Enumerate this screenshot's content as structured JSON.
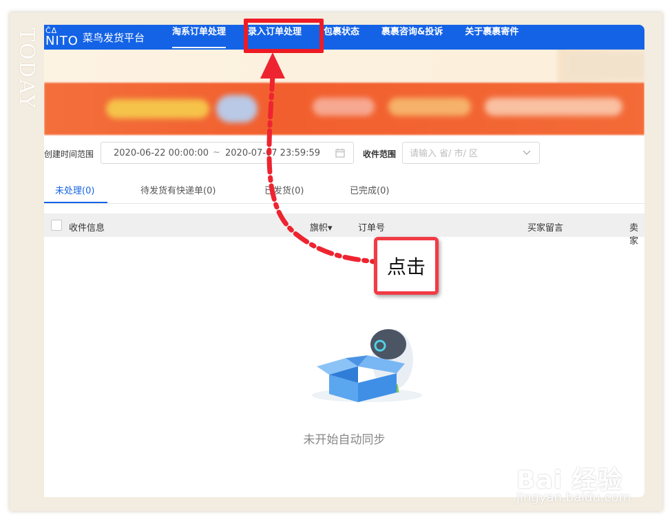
{
  "frame": {
    "tape_text": "TODAY"
  },
  "app": {
    "logo_mark": "ČΔ\nNITO",
    "logo_mark_line1": "ČΔ",
    "logo_mark_line2": "NITO",
    "logo_text": "菜鸟发货平台"
  },
  "nav": {
    "items": [
      {
        "label": "淘系订单处理",
        "active": true
      },
      {
        "label": "录入订单处理",
        "active": false
      },
      {
        "label": "包裹状态",
        "active": false
      },
      {
        "label": "裹裹咨询&投诉",
        "active": false
      },
      {
        "label": "关于裹裹寄件",
        "active": false
      }
    ]
  },
  "filters": {
    "created_label": "创建时间范围",
    "date_start": "2020-06-22 00:00:00",
    "date_sep": "~",
    "date_end": "2020-07-07 23:59:59",
    "region_label": "收件范围",
    "region_placeholder": "请输入 省/ 市/ 区"
  },
  "tabs": [
    {
      "label": "未处理(0)",
      "active": true
    },
    {
      "label": "待发货有快递单(0)",
      "active": false
    },
    {
      "label": "已发货(0)",
      "active": false
    },
    {
      "label": "已完成(0)",
      "active": false
    }
  ],
  "table": {
    "columns": [
      "收件信息",
      "旗帜▾",
      "订单号",
      "买家留言",
      "卖家"
    ]
  },
  "empty_state": {
    "text": "未开始自动同步"
  },
  "annotation": {
    "callout_text": "点击"
  },
  "watermark": {
    "main": "Bai 经验",
    "sub": "jingyan.baidu.com"
  },
  "colors": {
    "nav_blue": "#1463e6",
    "highlight_red": "#ee1b24",
    "tab_active": "#1463e6"
  }
}
